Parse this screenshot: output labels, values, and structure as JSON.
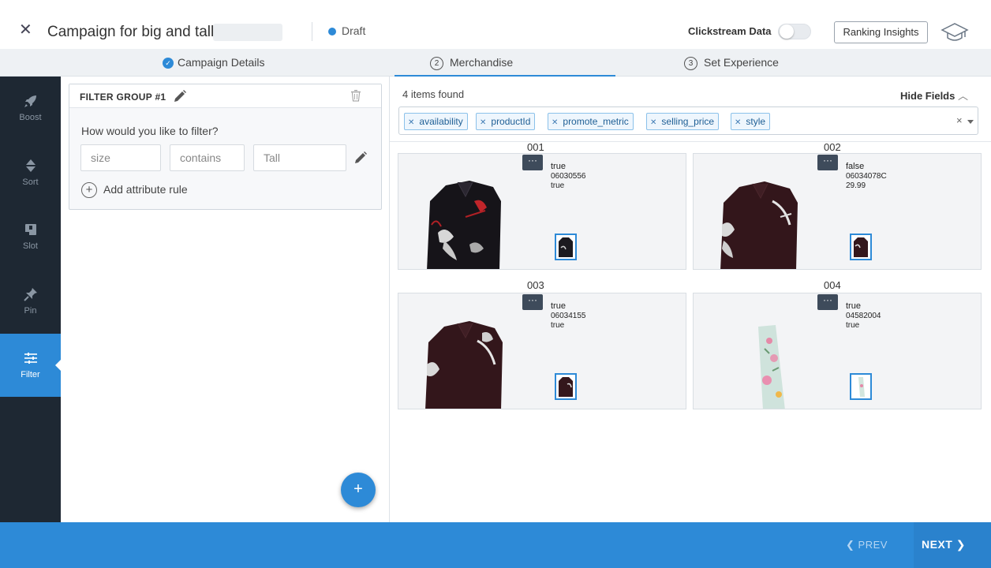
{
  "header": {
    "close_icon": "close-icon",
    "title": "Campaign for big and tall",
    "status": "Draft",
    "status_color": "#2d8ad7",
    "clickstream_label": "Clickstream Data",
    "clickstream_on": false,
    "ranking_button": "Ranking Insights",
    "help_icon": "graduation-cap-icon"
  },
  "steps": [
    {
      "label": "Campaign Details",
      "marker": "check",
      "state": "done"
    },
    {
      "label": "Merchandise",
      "marker": "2",
      "state": "active"
    },
    {
      "label": "Set Experience",
      "marker": "3",
      "state": "pending"
    }
  ],
  "sidebar": {
    "items": [
      {
        "label": "Boost",
        "icon": "rocket-icon"
      },
      {
        "label": "Sort",
        "icon": "sort-icon"
      },
      {
        "label": "Slot",
        "icon": "slot-icon"
      },
      {
        "label": "Pin",
        "icon": "pin-icon"
      },
      {
        "label": "Filter",
        "icon": "filter-icon",
        "active": true
      }
    ]
  },
  "filter": {
    "group_title": "FILTER GROUP #1",
    "question": "How would you like to filter?",
    "rule": {
      "attribute": "size",
      "operator": "contains",
      "value": "Tall"
    },
    "add_rule_label": "Add attribute rule",
    "fab_label": "+"
  },
  "results": {
    "count_label": "4 items found",
    "hide_fields_label": "Hide Fields",
    "tags": [
      "availability",
      "productId",
      "promote_metric",
      "selling_price",
      "style"
    ],
    "clear_label": "×",
    "more_label": "···",
    "items": [
      {
        "id": "001",
        "fields": [
          "true",
          "06030556",
          "true"
        ]
      },
      {
        "id": "002",
        "fields": [
          "false",
          "06034078C",
          "29.99"
        ]
      },
      {
        "id": "003",
        "fields": [
          "true",
          "06034155",
          "true"
        ]
      },
      {
        "id": "004",
        "fields": [
          "true",
          "04582004",
          "true"
        ]
      }
    ]
  },
  "footer": {
    "prev_label": "PREV",
    "next_label": "NEXT"
  },
  "colors": {
    "accent": "#2d8ad7",
    "sidebar_bg": "#1e2833",
    "tag_bg": "#eef6fd"
  }
}
